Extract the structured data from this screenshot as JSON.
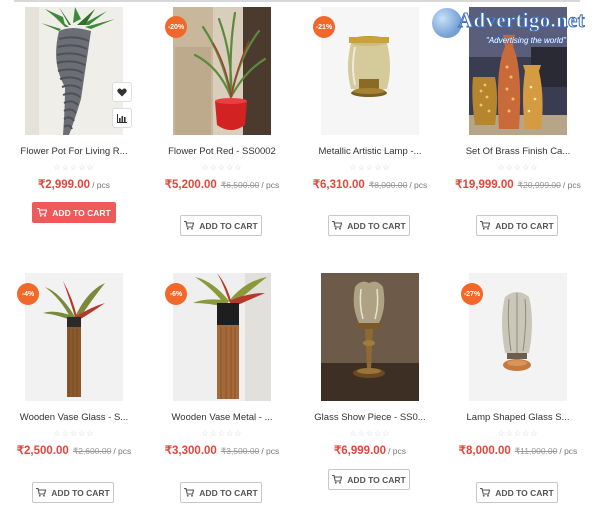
{
  "watermark": {
    "brand": "Advertigo.net",
    "tagline": "\"Advertising the world\""
  },
  "icons": {
    "wishlist": "heart-icon",
    "compare": "bar-chart-icon",
    "cart": "cart-icon",
    "stars": "star-rating"
  },
  "colors": {
    "price": "#e0463b",
    "badge": "#f2682a",
    "primary_button": "#ee5a5a"
  },
  "products": [
    {
      "name": "Flower Pot For Living R...",
      "badge": "",
      "price": "₹2,999.00",
      "old_price": "",
      "unit": "/ pcs",
      "button": "ADD TO CART",
      "rating": "☆☆☆☆☆",
      "button_highlighted": true
    },
    {
      "name": "Flower Pot Red - SS0002",
      "badge": "-20%",
      "price": "₹5,200.00",
      "old_price": "₹6,500.00",
      "unit": "/ pcs",
      "button": "ADD TO CART",
      "rating": "☆☆☆☆☆"
    },
    {
      "name": "Metallic Artistic Lamp -...",
      "badge": "-21%",
      "price": "₹6,310.00",
      "old_price": "₹8,000.00",
      "unit": "/ pcs",
      "button": "ADD TO CART",
      "rating": "☆☆☆☆☆"
    },
    {
      "name": "Set Of Brass Finish Ca...",
      "badge": "",
      "price": "₹19,999.00",
      "old_price": "₹20,999.00",
      "unit": "/ pcs",
      "button": "ADD TO CART",
      "rating": "☆☆☆☆☆"
    },
    {
      "name": "Wooden Vase Glass - S...",
      "badge": "-4%",
      "price": "₹2,500.00",
      "old_price": "₹2,600.00",
      "unit": "/ pcs",
      "button": "ADD TO CART",
      "rating": "☆☆☆☆☆"
    },
    {
      "name": "Wooden Vase Metal - ...",
      "badge": "-6%",
      "price": "₹3,300.00",
      "old_price": "₹3,500.00",
      "unit": "/ pcs",
      "button": "ADD TO CART",
      "rating": "☆☆☆☆☆"
    },
    {
      "name": "Glass Show Piece - SS0...",
      "badge": "",
      "price": "₹6,999.00",
      "old_price": "",
      "unit": "/ pcs",
      "button": "ADD TO CART",
      "rating": "☆☆☆☆☆"
    },
    {
      "name": "Lamp Shaped Glass S...",
      "badge": "-27%",
      "price": "₹8,000.00",
      "old_price": "₹11,000.00",
      "unit": "/ pcs",
      "button": "ADD TO CART",
      "rating": "☆☆☆☆☆"
    }
  ]
}
